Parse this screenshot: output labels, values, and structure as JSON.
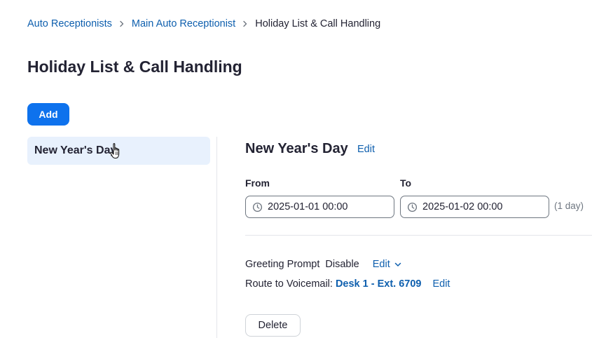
{
  "breadcrumb": {
    "items": [
      "Auto Receptionists",
      "Main Auto Receptionist"
    ],
    "current": "Holiday List & Call Handling"
  },
  "page": {
    "title": "Holiday List & Call Handling"
  },
  "toolbar": {
    "add_label": "Add"
  },
  "holidays": {
    "items": [
      {
        "label": "New Year's Day"
      }
    ]
  },
  "detail": {
    "title": "New Year's Day",
    "edit_label": "Edit",
    "from_label": "From",
    "to_label": "To",
    "from_value": "2025-01-01 00:00",
    "to_value": "2025-01-02 00:00",
    "duration": "(1 day)",
    "greeting": {
      "label": "Greeting Prompt",
      "value": "Disable",
      "edit_label": "Edit"
    },
    "voicemail": {
      "label": "Route to Voicemail:",
      "target": "Desk 1 - Ext. 6709",
      "edit_label": "Edit"
    },
    "delete_label": "Delete"
  },
  "icons": {
    "clock": "clock-icon",
    "chevron": "chevron-down-icon",
    "separator": "chevron-right-icon",
    "cursor": "hand-pointer-icon"
  },
  "colors": {
    "accent": "#0e72ed",
    "link": "#0e5fae",
    "selected_bg": "#e8f1fd",
    "text": "#232333",
    "muted": "#6e7680"
  }
}
